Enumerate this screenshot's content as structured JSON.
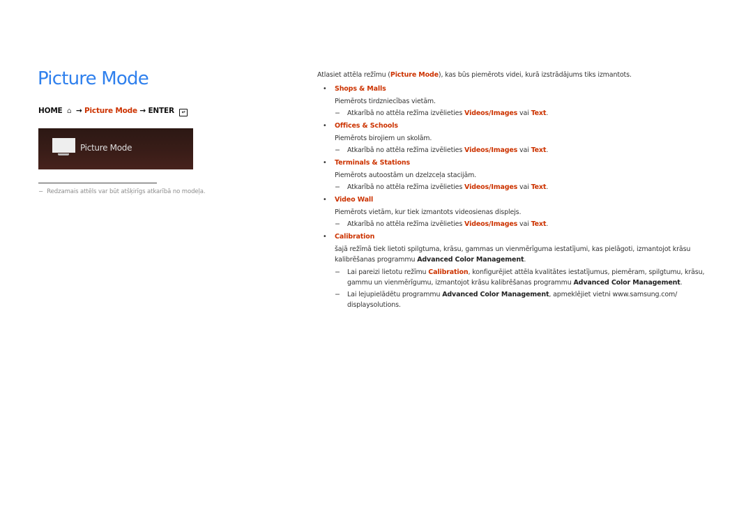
{
  "page": {
    "title": "Picture Mode",
    "path": {
      "home": "HOME",
      "home_icon": "home-icon",
      "arrow1": "→",
      "menu": "Picture Mode",
      "arrow2": "→",
      "enter": "ENTER",
      "enter_icon": "enter-icon"
    },
    "panel": {
      "icon": "monitor-icon",
      "label": "Picture Mode"
    },
    "footnote": "Redzamais attēls var būt atšķirīgs atkarībā no modeļa.",
    "footnote_dash": "−"
  },
  "content": {
    "intro_before": "Atlasiet attēla režīmu (",
    "intro_term": "Picture Mode",
    "intro_after": "), kas būs piemērots videi, kurā izstrādājums tiks izmantots.",
    "bullet": "•",
    "dash": "−",
    "items": [
      {
        "title": "Shops & Malls",
        "desc": "Piemērots tirdzniecības vietām.",
        "note_before": "Atkarībā no attēla režīma izvēlieties ",
        "note_term1": "Videos/Images",
        "note_mid": " vai ",
        "note_term2": "Text",
        "note_after": "."
      },
      {
        "title": "Offices & Schools",
        "desc": "Piemērots birojiem un skolām.",
        "note_before": "Atkarībā no attēla režīma izvēlieties ",
        "note_term1": "Videos/Images",
        "note_mid": " vai ",
        "note_term2": "Text",
        "note_after": "."
      },
      {
        "title": "Terminals & Stations",
        "desc": "Piemērots autoostām un dzelzceļa stacijām.",
        "note_before": "Atkarībā no attēla režīma izvēlieties ",
        "note_term1": "Videos/Images",
        "note_mid": " vai ",
        "note_term2": "Text",
        "note_after": "."
      },
      {
        "title": "Video Wall",
        "desc": "Piemērots vietām, kur tiek izmantots videosienas displejs.",
        "note_before": "Atkarībā no attēla režīma izvēlieties ",
        "note_term1": "Videos/Images",
        "note_mid": " vai ",
        "note_term2": "Text",
        "note_after": "."
      }
    ],
    "calibration": {
      "title": "Calibration",
      "desc_before": "šajā režīmā tiek lietoti spilgtuma, krāsu, gammas un vienmērīguma iestatījumi, kas pielāgoti, izmantojot krāsu kalibrēšanas programmu ",
      "desc_term": "Advanced Color Management",
      "desc_after": ".",
      "note1_before": "Lai pareizi lietotu režīmu ",
      "note1_term1": "Calibration",
      "note1_mid": ", konfigurējiet attēla kvalitātes iestatījumus, piemēram, spilgtumu, krāsu, gammu un vienmērīgumu, izmantojot krāsu kalibrēšanas programmu ",
      "note1_term2": "Advanced Color Management",
      "note1_after": ".",
      "note2_before": "Lai lejupielādētu programmu ",
      "note2_term": "Advanced Color Management",
      "note2_after": ", apmeklējiet vietni www.samsung.com/ displaysolutions."
    }
  }
}
